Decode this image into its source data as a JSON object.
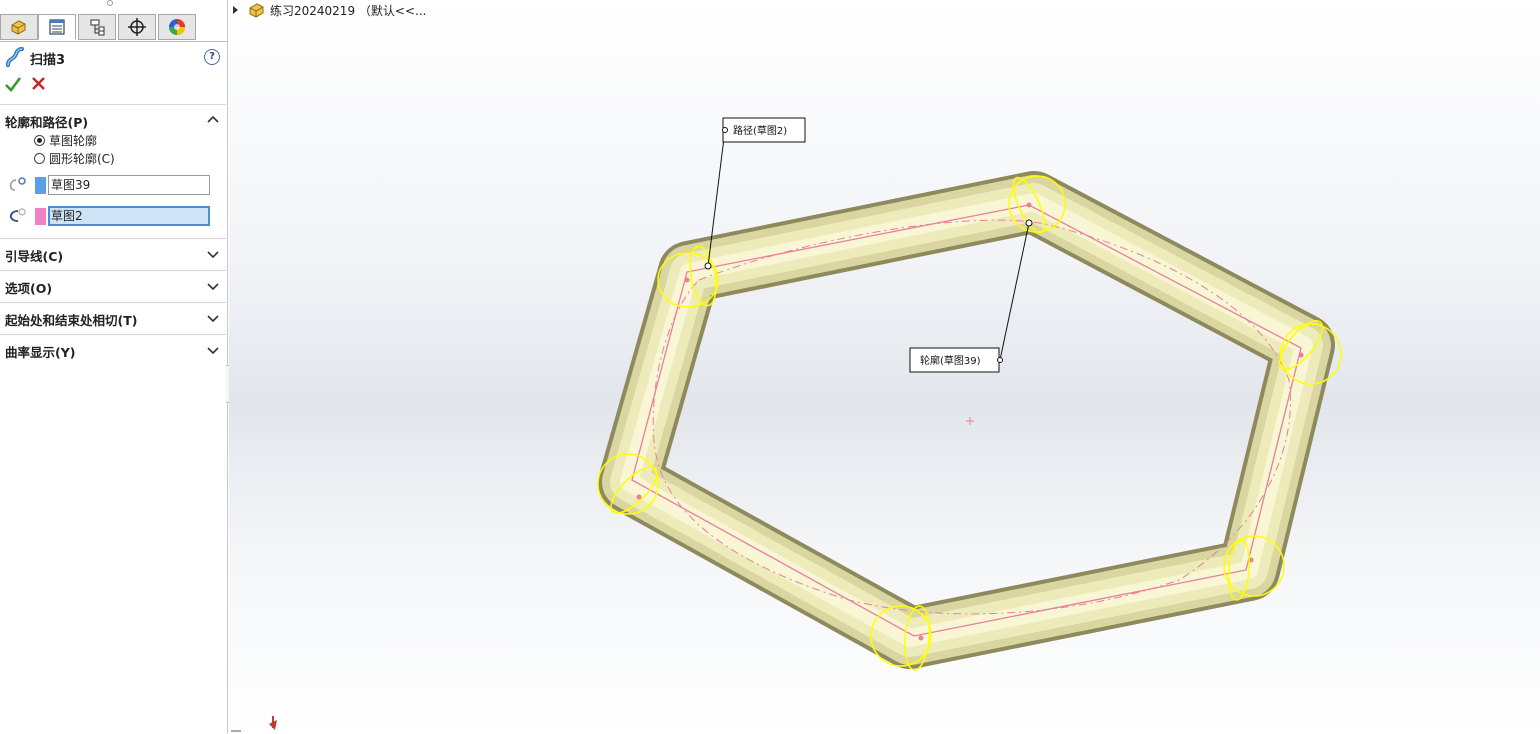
{
  "feature": {
    "title": "扫描3",
    "help": "?"
  },
  "sections": {
    "profile_path": {
      "title": "轮廓和路径(P)"
    },
    "guides": {
      "title": "引导线(C)"
    },
    "options": {
      "title": "选项(O)"
    },
    "tangency": {
      "title": "起始处和结束处相切(T)"
    },
    "curvature": {
      "title": "曲率显示(Y)"
    }
  },
  "profile_options": [
    {
      "label": "草图轮廓",
      "checked": true
    },
    {
      "label": "圆形轮廓(C)",
      "checked": false
    }
  ],
  "selections": {
    "profile": {
      "value": "草图39",
      "color": "#5aa0e6"
    },
    "path": {
      "value": "草图2",
      "color": "#ee82c4"
    }
  },
  "viewport": {
    "tree_root": "练习20240219 （默认<<...",
    "callout_path": "路径(草图2)",
    "callout_profile": "轮廓(草图39)"
  },
  "colors": {
    "accent": "#4a8fd6",
    "ok": "#2e9e2e",
    "cancel": "#cc2222",
    "body": "#f4f2c2",
    "highlight": "#ffff00",
    "sketch": "#e87f9c"
  }
}
